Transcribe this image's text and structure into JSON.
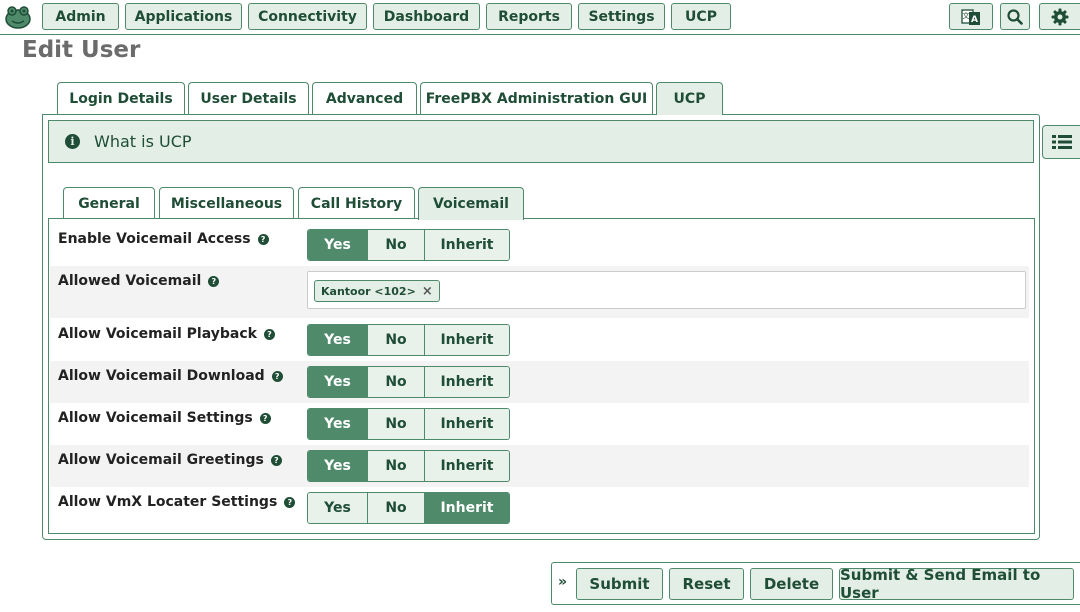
{
  "nav": {
    "items": [
      "Admin",
      "Applications",
      "Connectivity",
      "Dashboard",
      "Reports",
      "Settings",
      "UCP"
    ],
    "icons": [
      "language-icon",
      "search-icon",
      "gear-icon"
    ]
  },
  "page": {
    "title": "Edit User"
  },
  "tabs": [
    "Login Details",
    "User Details",
    "Advanced",
    "FreePBX Administration GUI",
    "UCP"
  ],
  "active_tab": "UCP",
  "info": {
    "text": "What is UCP"
  },
  "subtabs": [
    "General",
    "Miscellaneous",
    "Call History",
    "Voicemail"
  ],
  "active_subtab": "Voicemail",
  "options": {
    "yes": "Yes",
    "no": "No",
    "inherit": "Inherit"
  },
  "settings": [
    {
      "label": "Enable Voicemail Access",
      "value": "Yes"
    },
    {
      "label": "Allowed Voicemail",
      "chip": "Kantoor <102>",
      "chip_remove": "×"
    },
    {
      "label": "Allow Voicemail Playback",
      "value": "Yes"
    },
    {
      "label": "Allow Voicemail Download",
      "value": "Yes"
    },
    {
      "label": "Allow Voicemail Settings",
      "value": "Yes"
    },
    {
      "label": "Allow Voicemail Greetings",
      "value": "Yes"
    },
    {
      "label": "Allow VmX Locater Settings",
      "value": "Inherit"
    }
  ],
  "footer": {
    "chevron": "»",
    "submit": "Submit",
    "reset": "Reset",
    "delete": "Delete",
    "submit_email": "Submit & Send Email to User"
  },
  "colors": {
    "accent": "#4f8b6b",
    "accent_light": "#e3efe6",
    "text_dark": "#1f4d36"
  }
}
